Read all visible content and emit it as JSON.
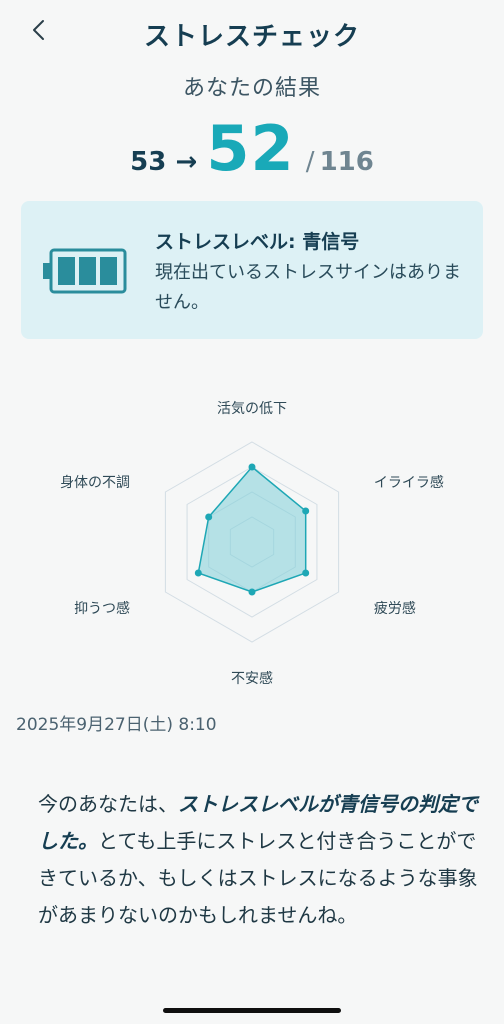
{
  "header": {
    "title": "ストレスチェック",
    "back_icon": "chevron-left-icon"
  },
  "result": {
    "subtitle": "あなたの結果",
    "previous_score": "53",
    "arrow": "→",
    "current_score": "52",
    "separator": "/",
    "max_score": "116"
  },
  "level_card": {
    "title": "ストレスレベル: 青信号",
    "description": "現在出ているストレスサインはありません。",
    "icon": "battery-full-icon",
    "battery_level": 1.0
  },
  "radar": {
    "axes": [
      {
        "label": "活気の低下",
        "value": 0.75
      },
      {
        "label": "イライラ感",
        "value": 0.62
      },
      {
        "label": "疲労感",
        "value": 0.62
      },
      {
        "label": "不安感",
        "value": 0.5
      },
      {
        "label": "抑うつ感",
        "value": 0.62
      },
      {
        "label": "身体の不調",
        "value": 0.5
      }
    ],
    "colors": {
      "grid": "#d3dde4",
      "stroke": "#1ea7b5",
      "fill": "#7fd0d9"
    }
  },
  "date": "2025年9月27日(土) 8:10",
  "summary": {
    "lead": "今のあなたは、",
    "emphasis": "ストレスレベルが青信号の判定でした。",
    "rest": "とても上手にストレスと付き合うことができているか、もしくはストレスになるような事象があまりないのかもしれませんね。"
  },
  "colors": {
    "accent": "#19a9b8",
    "card_bg": "#ddf1f5",
    "text_dark": "#163e52",
    "battery": "#2a8d9c"
  }
}
